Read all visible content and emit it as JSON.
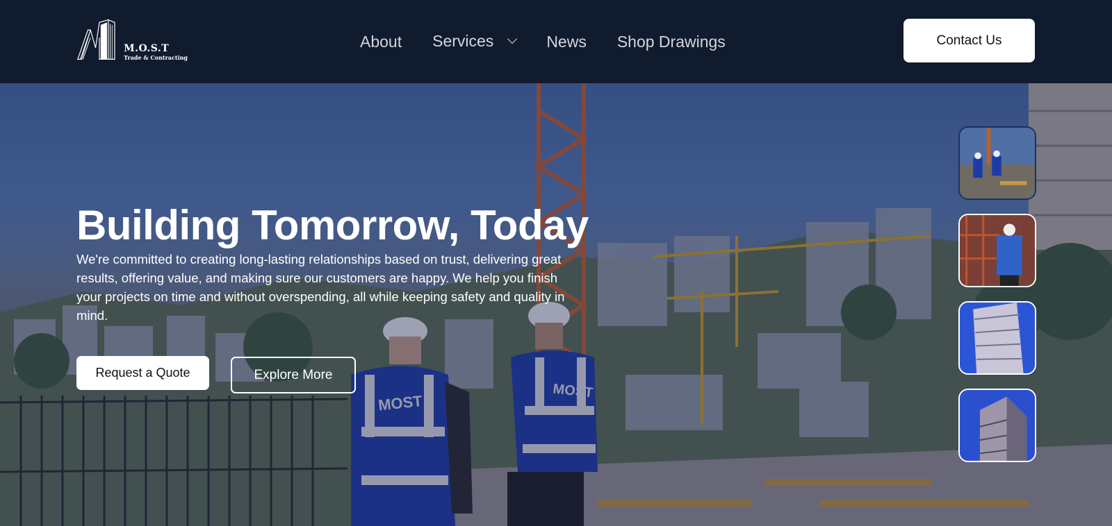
{
  "header": {
    "logo": {
      "name": "M.O.S.T",
      "subtitle": "Trade & Contracting"
    },
    "nav": [
      {
        "label": "About"
      },
      {
        "label": "Services",
        "has_dropdown": true
      },
      {
        "label": "News"
      },
      {
        "label": "Shop Drawings"
      }
    ],
    "contact_label": "Contact Us"
  },
  "hero": {
    "title": "Building Tomorrow, Today",
    "description": "We're committed to creating long-lasting relationships based on trust, delivering great results, offering value, and making sure our customers are happy. We help you finish your projects on time and without overspending, all while keeping safety and quality in mind.",
    "primary_button": "Request a Quote",
    "secondary_button": "Explore More",
    "vest_text": "MOST",
    "thumbnails": [
      {
        "name": "thumbnail-workers-site",
        "active": true
      },
      {
        "name": "thumbnail-worker-scaffold",
        "active": false
      },
      {
        "name": "thumbnail-building-facade",
        "active": false
      },
      {
        "name": "thumbnail-building-corner",
        "active": false
      }
    ]
  },
  "colors": {
    "header_bg": "#111b2e",
    "overlay": "rgba(20,28,80,0.38)",
    "button_bg": "#ffffff",
    "active_thumb_border": "#1d3160"
  }
}
